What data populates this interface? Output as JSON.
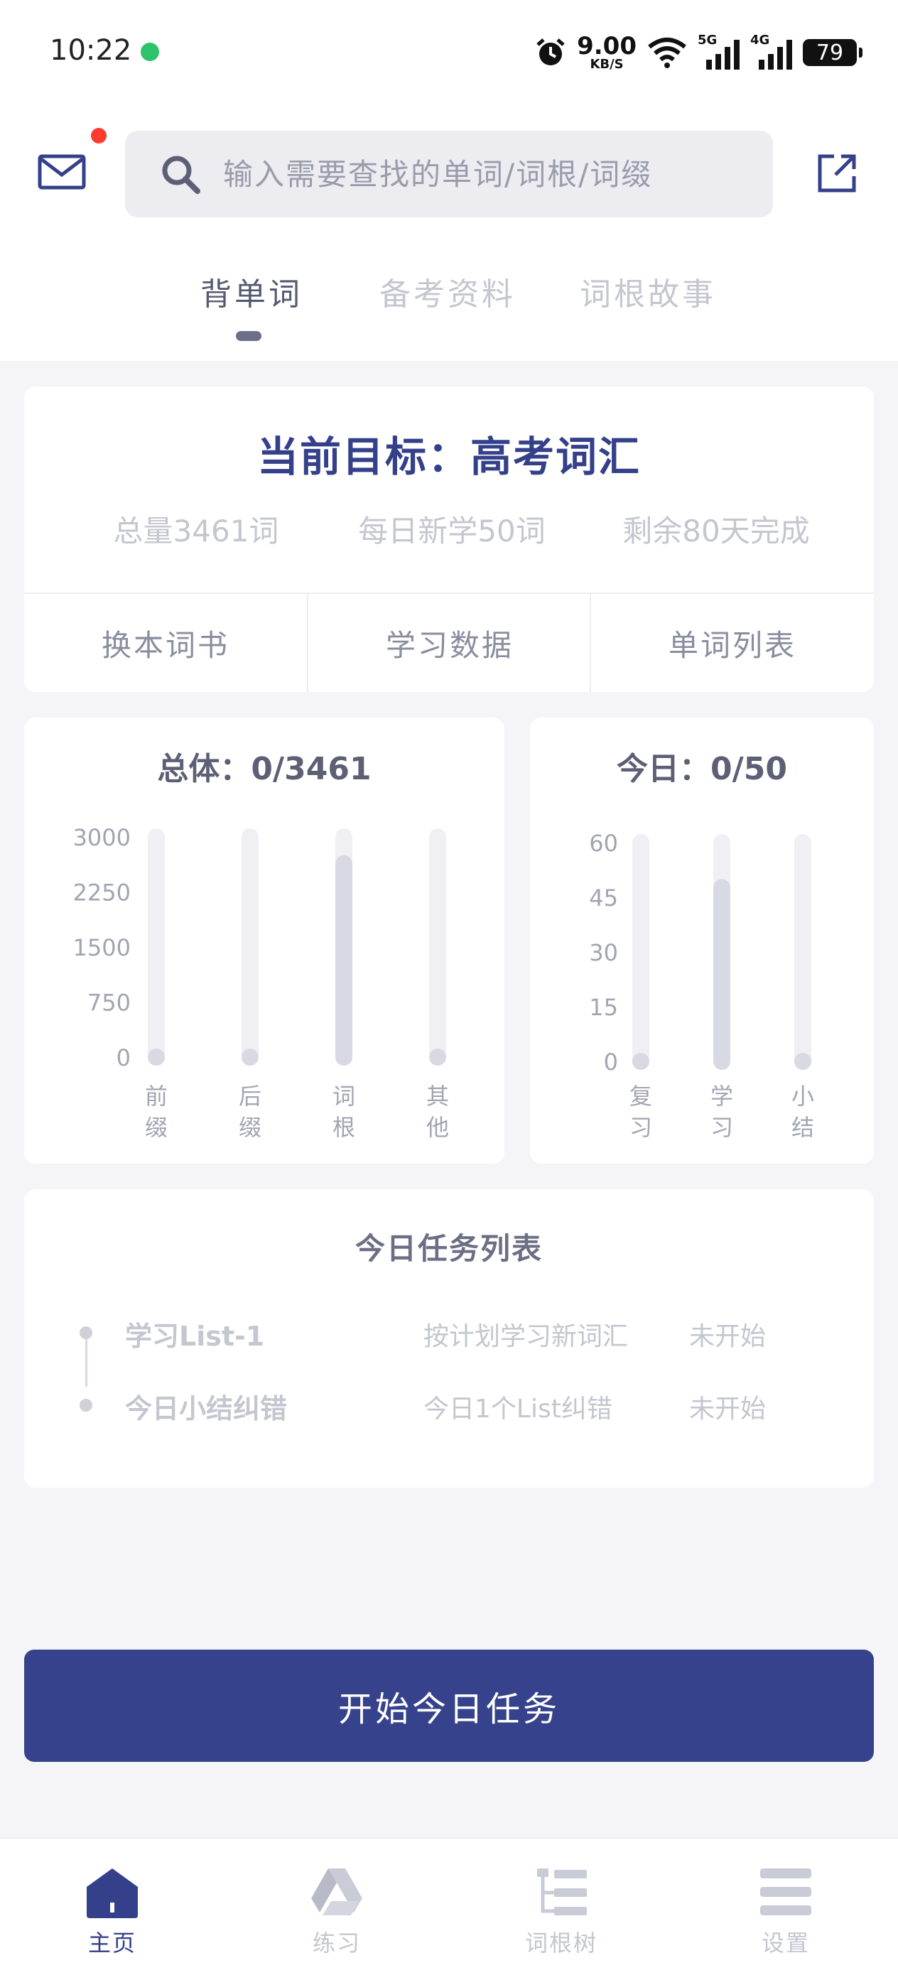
{
  "status_bar": {
    "time": "10:22",
    "speed_value": "9.00",
    "speed_unit": "KB/S",
    "network_1": "5G",
    "network_2": "4G",
    "battery": "79"
  },
  "search": {
    "placeholder": "输入需要查找的单词/词根/词缀"
  },
  "tabs": [
    {
      "label": "背单词",
      "active": true
    },
    {
      "label": "备考资料",
      "active": false
    },
    {
      "label": "词根故事",
      "active": false
    }
  ],
  "goal": {
    "title": "当前目标：高考词汇",
    "stats": [
      "总量3461词",
      "每日新学50词",
      "剩余80天完成"
    ],
    "actions": [
      "换本词书",
      "学习数据",
      "单词列表"
    ]
  },
  "chart_data": [
    {
      "type": "bar",
      "title": "总体：0/3461",
      "categories": [
        "前缀",
        "后缀",
        "词根",
        "其他"
      ],
      "values": [
        80,
        70,
        2750,
        70
      ],
      "yticks": [
        0,
        750,
        1500,
        2250,
        3000
      ],
      "ylim": [
        0,
        3000
      ],
      "grid": false,
      "legend": "none"
    },
    {
      "type": "bar",
      "title": "今日：0/50",
      "categories": [
        "复习",
        "学习",
        "小结"
      ],
      "values": [
        0,
        50,
        0
      ],
      "yticks": [
        0,
        15,
        30,
        45,
        60
      ],
      "ylim": [
        0,
        60
      ],
      "grid": false,
      "legend": "none"
    }
  ],
  "chart_colors": {
    "track": "#f0f0f4",
    "fill": "#d8d9e3",
    "tick_text": "#a2a4b2"
  },
  "tasks": {
    "title": "今日任务列表",
    "items": [
      {
        "name": "学习List-1",
        "desc": "按计划学习新词汇",
        "status": "未开始"
      },
      {
        "name": "今日小结纠错",
        "desc": "今日1个List纠错",
        "status": "未开始"
      }
    ]
  },
  "start_button": "开始今日任务",
  "bottom_nav": [
    {
      "label": "主页",
      "icon": "home-icon",
      "active": true
    },
    {
      "label": "练习",
      "icon": "drive-icon",
      "active": false
    },
    {
      "label": "词根树",
      "icon": "tree-list-icon",
      "active": false
    },
    {
      "label": "设置",
      "icon": "menu-icon",
      "active": false
    }
  ],
  "colors": {
    "accent": "#36438c",
    "notification": "#ff3b30"
  }
}
